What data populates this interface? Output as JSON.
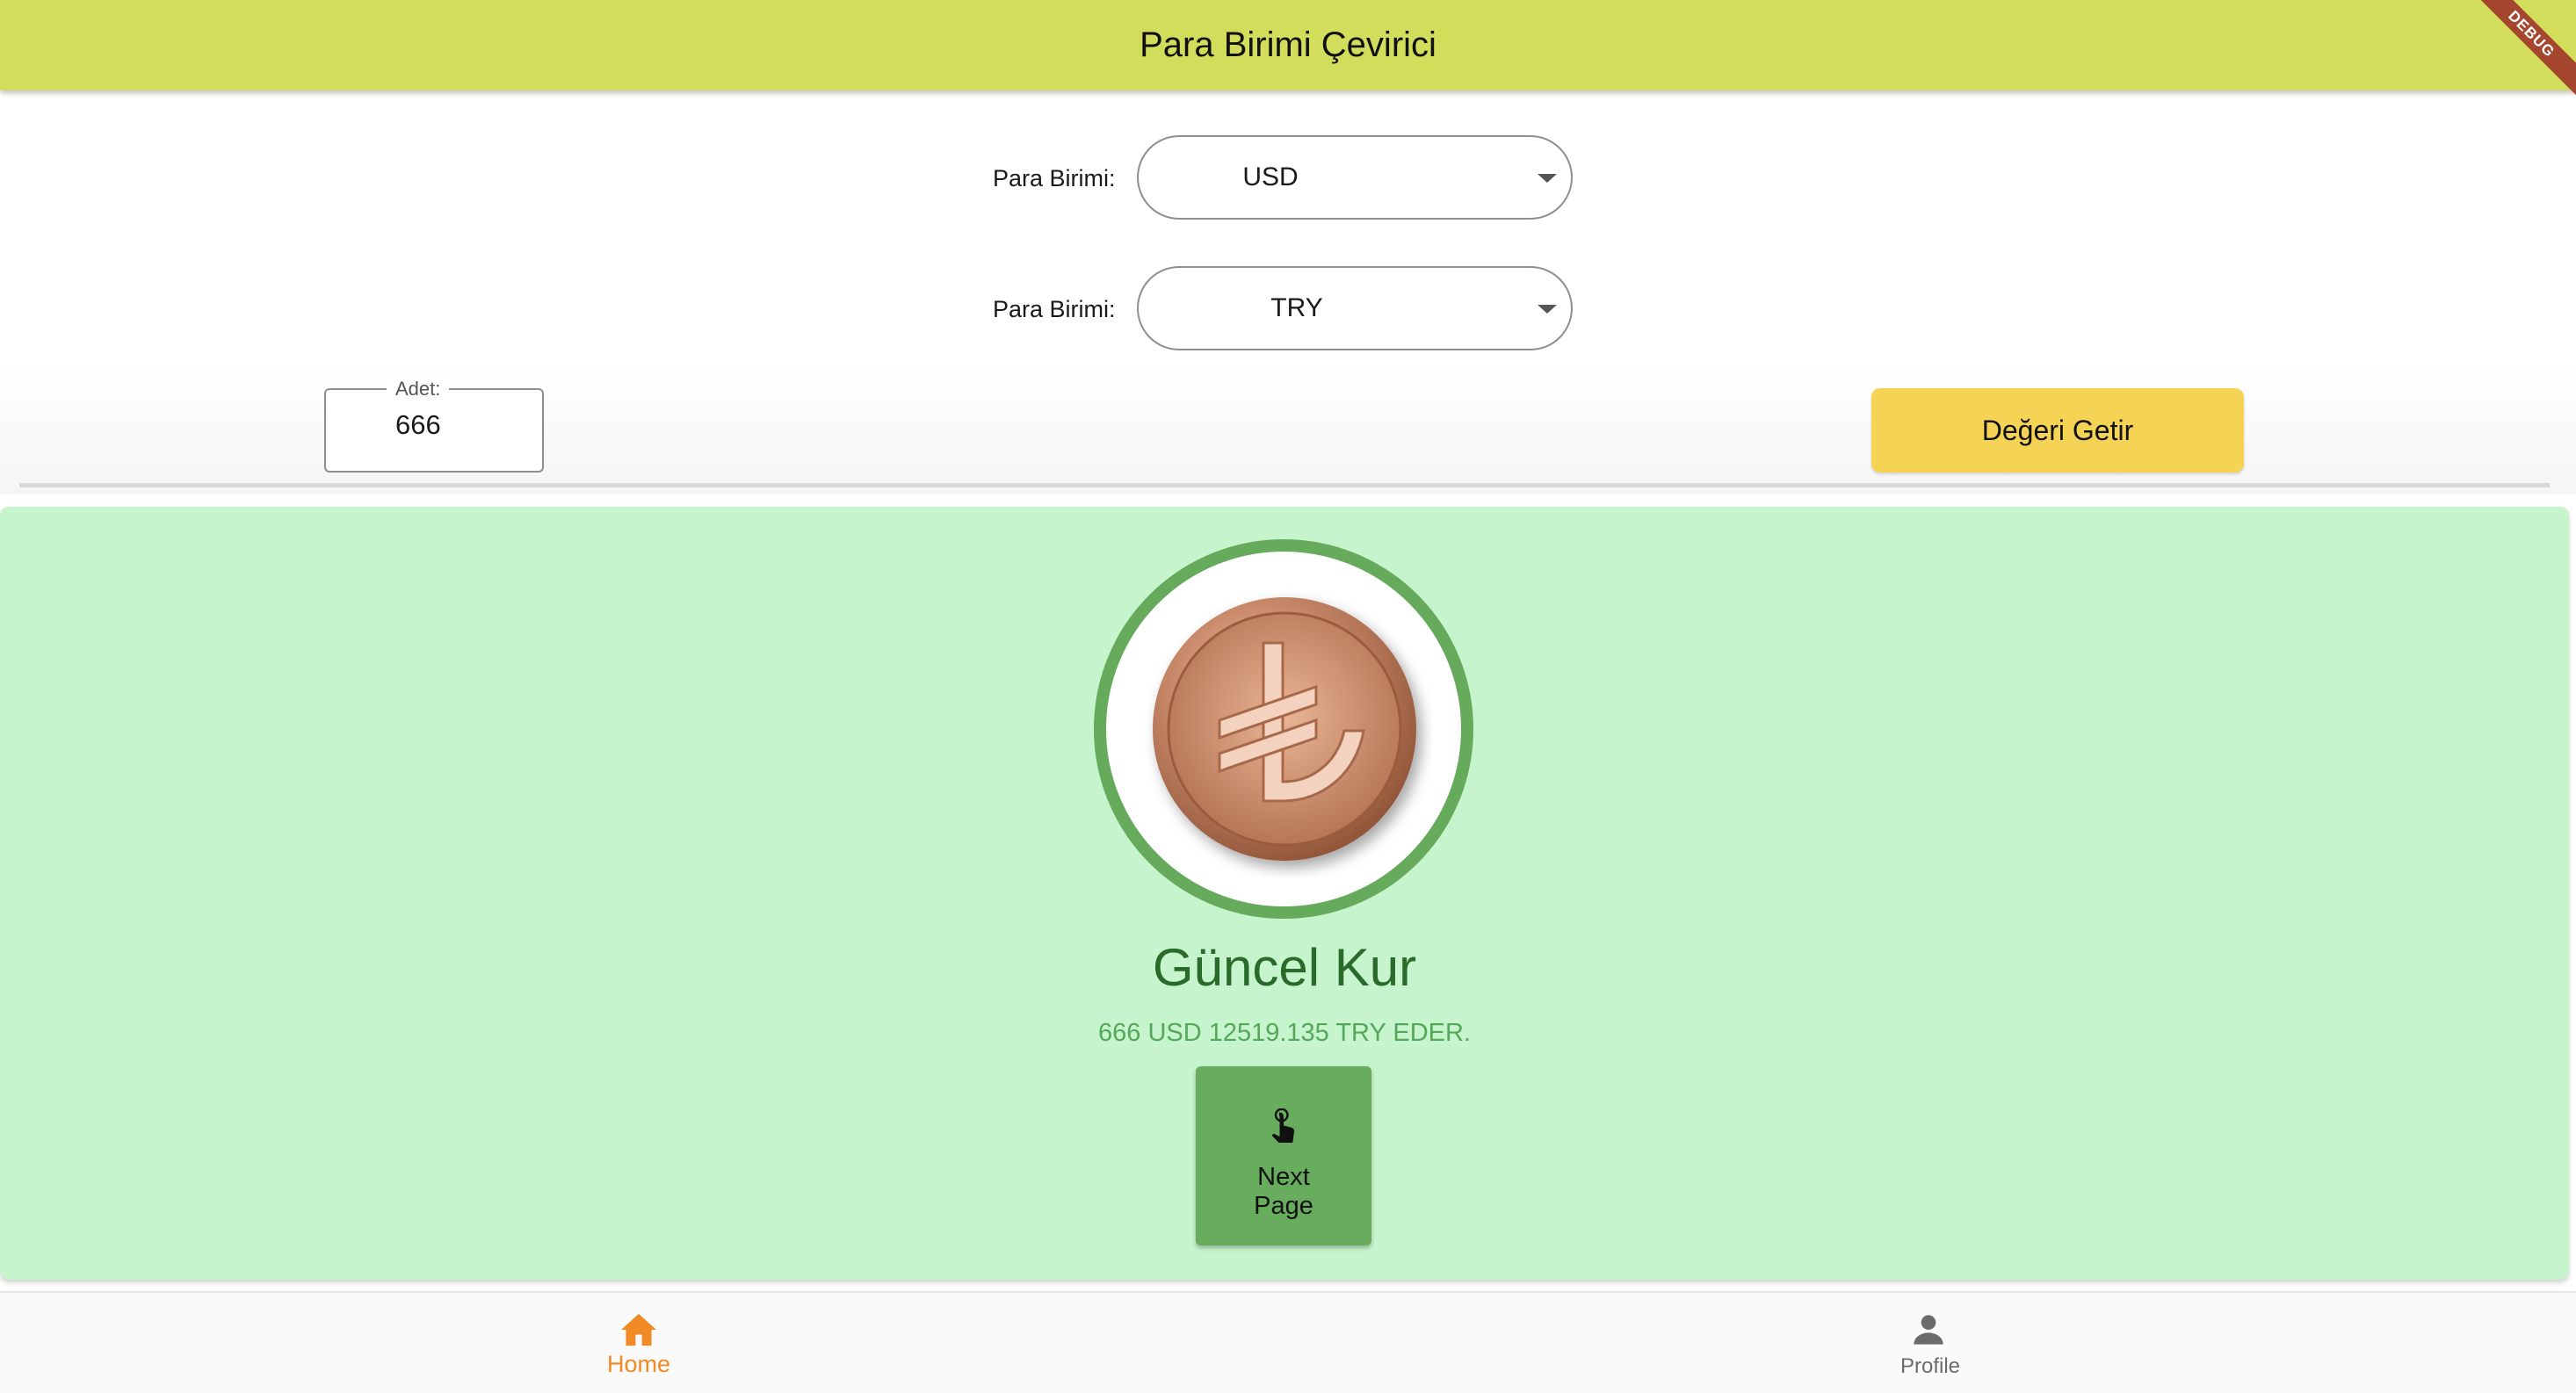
{
  "app_bar": {
    "title": "Para Birimi Çevirici",
    "debug_badge": "DEBUG"
  },
  "from_currency": {
    "label": "Para Birimi:",
    "selected": "USD"
  },
  "to_currency": {
    "label": "Para Birimi:",
    "selected": "TRY"
  },
  "amount": {
    "label": "Adet:",
    "value": "666"
  },
  "fetch_button": {
    "label": "Değeri Getir"
  },
  "result": {
    "title": "Güncel Kur",
    "text": "666 USD 12519.135 TRY EDER.",
    "icon": "turkish-lira-coin-icon"
  },
  "next_button": {
    "label_line1": "Next",
    "label_line2": "Page",
    "icon": "touch-app-icon"
  },
  "bottom_nav": {
    "items": [
      {
        "label": "Home",
        "icon": "home-icon",
        "active": true
      },
      {
        "label": "Profile",
        "icon": "person-icon",
        "active": false
      }
    ]
  },
  "colors": {
    "app_bar": "#d2dd5c",
    "fetch_button": "#f5d355",
    "result_background": "#c5f4cd",
    "accent_green": "#66aa5b",
    "nav_active": "#f08a24",
    "nav_inactive": "#6b6b6b"
  }
}
